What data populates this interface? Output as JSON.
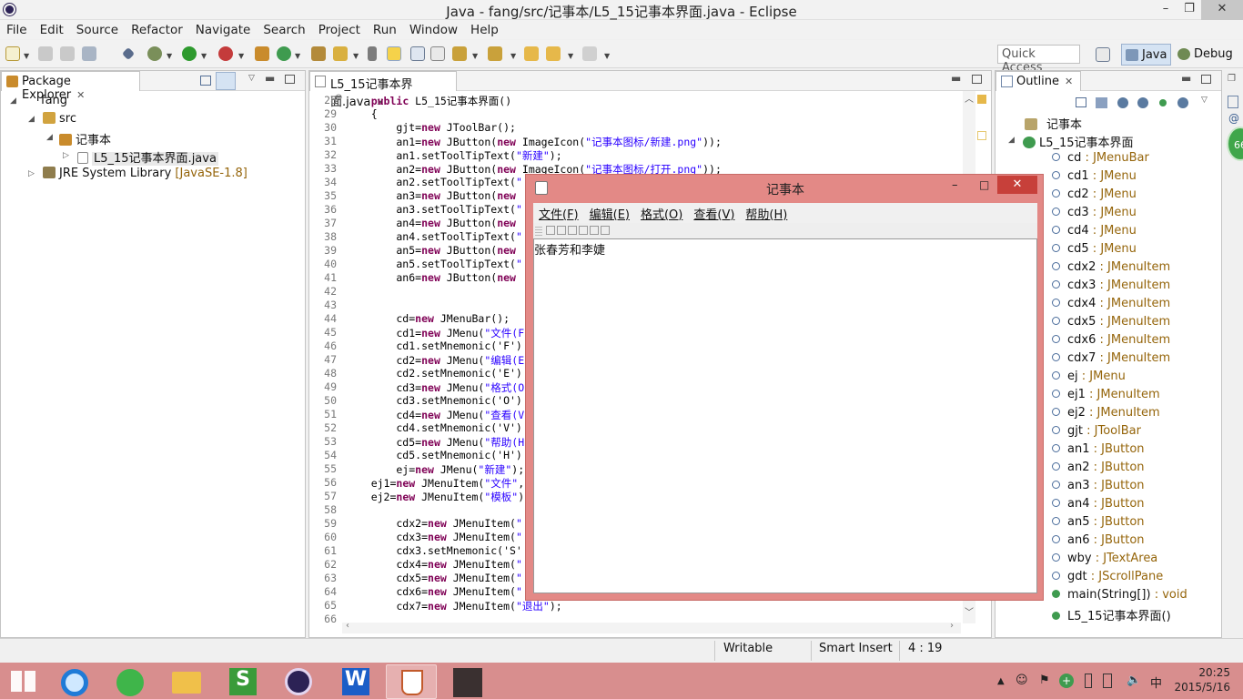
{
  "window": {
    "title": "Java - fang/src/记事本/L5_15记事本界面.java - Eclipse",
    "minimize": "–",
    "maximize": "❐",
    "close": "✕"
  },
  "menu": [
    "File",
    "Edit",
    "Source",
    "Refactor",
    "Navigate",
    "Search",
    "Project",
    "Run",
    "Window",
    "Help"
  ],
  "toolbar": {
    "quick_access_placeholder": "Quick Access",
    "perspectives": [
      "Java",
      "Debug"
    ]
  },
  "package_explorer": {
    "tab_label": "Package Explorer",
    "project": "fang",
    "src": "src",
    "package": "记事本",
    "file": "L5_15记事本界面.java",
    "library": "JRE System Library",
    "library_version": "[JavaSE-1.8]"
  },
  "editor": {
    "tab_label": "L5_15记事本界面.java",
    "lines": [
      {
        "n": "28",
        "c": "    public L5_15记事本界面()"
      },
      {
        "n": "29",
        "c": "    {"
      },
      {
        "n": "30",
        "c": "        gjt=new JToolBar();"
      },
      {
        "n": "31",
        "c": "        an1=new JButton(new ImageIcon(\"记事本图标/新建.png\"));"
      },
      {
        "n": "32",
        "c": "        an1.setToolTipText(\"新建\");"
      },
      {
        "n": "33",
        "c": "        an2=new JButton(new ImageIcon(\"记事本图标/打开.png\"));"
      },
      {
        "n": "34",
        "c": "        an2.setToolTipText(\""
      },
      {
        "n": "35",
        "c": "        an3=new JButton(new"
      },
      {
        "n": "36",
        "c": "        an3.setToolTipText(\""
      },
      {
        "n": "37",
        "c": "        an4=new JButton(new"
      },
      {
        "n": "38",
        "c": "        an4.setToolTipText(\""
      },
      {
        "n": "39",
        "c": "        an5=new JButton(new"
      },
      {
        "n": "40",
        "c": "        an5.setToolTipText(\""
      },
      {
        "n": "41",
        "c": "        an6=new JButton(new"
      },
      {
        "n": "42",
        "c": ""
      },
      {
        "n": "43",
        "c": ""
      },
      {
        "n": "44",
        "c": "        cd=new JMenuBar();"
      },
      {
        "n": "45",
        "c": "        cd1=new JMenu(\"文件(F)"
      },
      {
        "n": "46",
        "c": "        cd1.setMnemonic('F')"
      },
      {
        "n": "47",
        "c": "        cd2=new JMenu(\"编辑(E)"
      },
      {
        "n": "48",
        "c": "        cd2.setMnemonic('E')"
      },
      {
        "n": "49",
        "c": "        cd3=new JMenu(\"格式(O)"
      },
      {
        "n": "50",
        "c": "        cd3.setMnemonic('O')"
      },
      {
        "n": "51",
        "c": "        cd4=new JMenu(\"查看(V)"
      },
      {
        "n": "52",
        "c": "        cd4.setMnemonic('V')"
      },
      {
        "n": "53",
        "c": "        cd5=new JMenu(\"帮助(H)"
      },
      {
        "n": "54",
        "c": "        cd5.setMnemonic('H')"
      },
      {
        "n": "55",
        "c": "        ej=new JMenu(\"新建\");"
      },
      {
        "n": "56",
        "c": "    ej1=new JMenuItem(\"文件\",n"
      },
      {
        "n": "57",
        "c": "    ej2=new JMenuItem(\"模板\");"
      },
      {
        "n": "58",
        "c": ""
      },
      {
        "n": "59",
        "c": "        cdx2=new JMenuItem(\""
      },
      {
        "n": "60",
        "c": "        cdx3=new JMenuItem(\""
      },
      {
        "n": "61",
        "c": "        cdx3.setMnemonic('S'"
      },
      {
        "n": "62",
        "c": "        cdx4=new JMenuItem(\""
      },
      {
        "n": "63",
        "c": "        cdx5=new JMenuItem(\""
      },
      {
        "n": "64",
        "c": "        cdx6=new JMenuItem(\""
      },
      {
        "n": "65",
        "c": "        cdx7=new JMenuItem(\"退出\");"
      },
      {
        "n": "66",
        "c": ""
      }
    ]
  },
  "outline": {
    "tab_label": "Outline",
    "package": "记事本",
    "class": "L5_15记事本界面",
    "members": [
      {
        "name": "cd",
        "type": "JMenuBar"
      },
      {
        "name": "cd1",
        "type": "JMenu"
      },
      {
        "name": "cd2",
        "type": "JMenu"
      },
      {
        "name": "cd3",
        "type": "JMenu"
      },
      {
        "name": "cd4",
        "type": "JMenu"
      },
      {
        "name": "cd5",
        "type": "JMenu"
      },
      {
        "name": "cdx2",
        "type": "JMenuItem"
      },
      {
        "name": "cdx3",
        "type": "JMenuItem"
      },
      {
        "name": "cdx4",
        "type": "JMenuItem"
      },
      {
        "name": "cdx5",
        "type": "JMenuItem"
      },
      {
        "name": "cdx6",
        "type": "JMenuItem"
      },
      {
        "name": "cdx7",
        "type": "JMenuItem"
      },
      {
        "name": "ej",
        "type": "JMenu"
      },
      {
        "name": "ej1",
        "type": "JMenuItem"
      },
      {
        "name": "ej2",
        "type": "JMenuItem"
      },
      {
        "name": "gjt",
        "type": "JToolBar"
      },
      {
        "name": "an1",
        "type": "JButton"
      },
      {
        "name": "an2",
        "type": "JButton"
      },
      {
        "name": "an3",
        "type": "JButton"
      },
      {
        "name": "an4",
        "type": "JButton"
      },
      {
        "name": "an5",
        "type": "JButton"
      },
      {
        "name": "an6",
        "type": "JButton"
      },
      {
        "name": "wby",
        "type": "JTextArea"
      },
      {
        "name": "gdt",
        "type": "JScrollPane"
      },
      {
        "name": "main(String[])",
        "type": "void"
      },
      {
        "name": "L5_15记事本界面()",
        "type": ""
      }
    ]
  },
  "notepad": {
    "title": "记事本",
    "menus": [
      "文件(F)",
      "编辑(E)",
      "格式(O)",
      "查看(V)",
      "帮助(H)"
    ],
    "text": "张春芳和李婕"
  },
  "status": {
    "writable": "Writable",
    "insert_mode": "Smart Insert",
    "position": "4 : 19"
  },
  "taskbar": {
    "time": "20:25",
    "date": "2015/5/16",
    "ime": "中"
  },
  "colors": {
    "taskbar": "#d88e8e",
    "notepad_frame": "#e38986",
    "keyword": "#7f0055",
    "string": "#2a00ff",
    "type_hint": "#95650b"
  }
}
